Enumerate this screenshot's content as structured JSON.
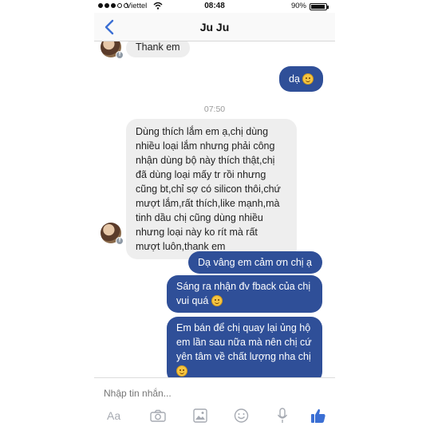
{
  "status": {
    "carrier": "Viettel",
    "time": "08:48",
    "battery": "90%",
    "battery_level": 0.9
  },
  "header": {
    "contact_name": "Ju Ju"
  },
  "messages": {
    "m1": {
      "side": "in",
      "text": "Thank em"
    },
    "m2": {
      "side": "out",
      "text": "dạ"
    },
    "timestamp": "07:50",
    "m3": {
      "side": "in",
      "lines": [
        "Dùng thích lắm em ạ,chị dùng",
        "nhiều loại lắm nhưng phải công",
        "nhận dùng bộ này thích thật,chị",
        "đã dùng loại mấy tr rồi nhưng",
        "cũng bt,chỉ sợ có silicon thôi,chứ",
        "mượt lắm,rất thích,like mạnh,mà",
        "tinh dầu chị cũng dùng nhiều",
        "nhưng loại này ko rít mà rất",
        "mượt luôn,thank em"
      ]
    },
    "m4": {
      "side": "out",
      "text": "Dạ vâng em cảm ơn chị ạ"
    },
    "m5": {
      "side": "out",
      "lines": [
        "Sáng ra nhận đv fback của chị",
        "vui quá"
      ]
    },
    "m6": {
      "side": "out",
      "lines": [
        "Em bán để chị quay lại ủng hộ",
        "em lần sau nữa mà nên chị cứ",
        "yên tâm về chất lượng nha chị"
      ]
    }
  },
  "composer": {
    "placeholder": "Nhập tin nhắn...",
    "text_tool": "Aa",
    "icons": [
      "camera-icon",
      "gallery-icon",
      "emoji-icon",
      "microphone-icon",
      "like-icon"
    ],
    "accent": "#2f4f98",
    "like_color": "#3b6fd4"
  }
}
